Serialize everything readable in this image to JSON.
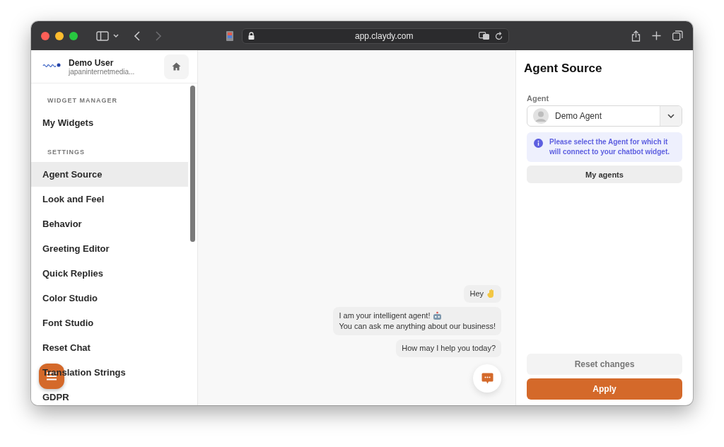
{
  "browser": {
    "url": "app.claydy.com"
  },
  "sidebar": {
    "user": {
      "name": "Demo User",
      "email": "japaninternetmedia..."
    },
    "sections": [
      {
        "heading": "WIDGET MANAGER",
        "items": [
          {
            "label": "My Widgets",
            "selected": false
          }
        ]
      },
      {
        "heading": "SETTINGS",
        "items": [
          {
            "label": "Agent Source",
            "selected": true
          },
          {
            "label": "Look and Feel",
            "selected": false
          },
          {
            "label": "Behavior",
            "selected": false
          },
          {
            "label": "Greeting Editor",
            "selected": false
          },
          {
            "label": "Quick Replies",
            "selected": false
          },
          {
            "label": "Color Studio",
            "selected": false
          },
          {
            "label": "Font Studio",
            "selected": false
          },
          {
            "label": "Reset Chat",
            "selected": false
          },
          {
            "label": "Translation Strings",
            "selected": false
          },
          {
            "label": "GDPR",
            "selected": false
          }
        ]
      }
    ]
  },
  "chat": {
    "messages": [
      {
        "lines": [
          "Hey"
        ]
      },
      {
        "lines": [
          "I am your intelligent agent!",
          "You can ask me anything about our business!"
        ]
      },
      {
        "lines": [
          "How may I help you today?"
        ]
      }
    ]
  },
  "panel": {
    "title": "Agent Source",
    "agent_label": "Agent",
    "agent_value": "Demo Agent",
    "info": "Please select the Agent for which it will connect to your chatbot widget.",
    "my_agents_button": "My agents",
    "reset_button": "Reset changes",
    "apply_button": "Apply"
  }
}
